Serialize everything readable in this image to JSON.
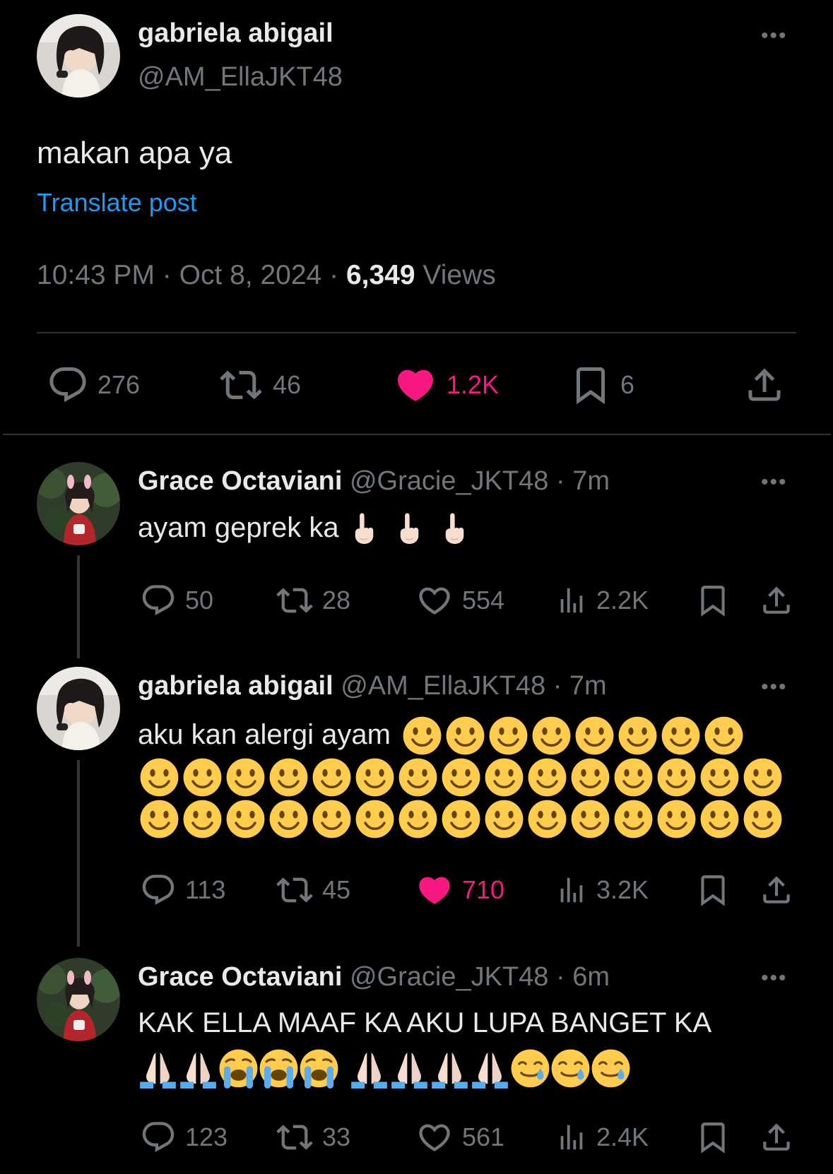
{
  "main": {
    "name": "gabriela abigail",
    "handle": "@AM_EllaJKT48",
    "text": "makan apa ya",
    "translate": "Translate post",
    "time": "10:43 PM",
    "sep1": "·",
    "date": "Oct 8, 2024",
    "sep2": "·",
    "views_count": "6,349",
    "views_label": "Views",
    "replies": "276",
    "reposts": "46",
    "likes": "1.2K",
    "bookmarks": "6"
  },
  "replies": [
    {
      "name": "Grace Octaviani",
      "handle": "@Gracie_JKT48",
      "time": "· 7m",
      "text": "ayam geprek ka",
      "replies": "50",
      "reposts": "28",
      "likes": "554",
      "views": "2.2K"
    },
    {
      "name": "gabriela abigail",
      "handle": "@AM_EllaJKT48",
      "time": "· 7m",
      "text": "aku kan alergi ayam",
      "replies": "113",
      "reposts": "45",
      "likes": "710",
      "views": "3.2K"
    },
    {
      "name": "Grace Octaviani",
      "handle": "@Gracie_JKT48",
      "time": "· 6m",
      "text": "KAK ELLA MAAF KA AKU LUPA BANGET KA",
      "replies": "123",
      "reposts": "33",
      "likes": "561",
      "views": "2.4K"
    }
  ],
  "colors": {
    "accent": "#1d9bf0",
    "like": "#f91880",
    "muted": "#71767b",
    "text": "#e7e9ea"
  },
  "icons": [
    "more-icon",
    "reply-icon",
    "repost-icon",
    "like-icon",
    "bookmark-icon",
    "share-icon",
    "views-icon",
    "point-up-emoji",
    "smile-emoji",
    "pray-emoji",
    "sob-emoji",
    "tear-smile-emoji"
  ]
}
